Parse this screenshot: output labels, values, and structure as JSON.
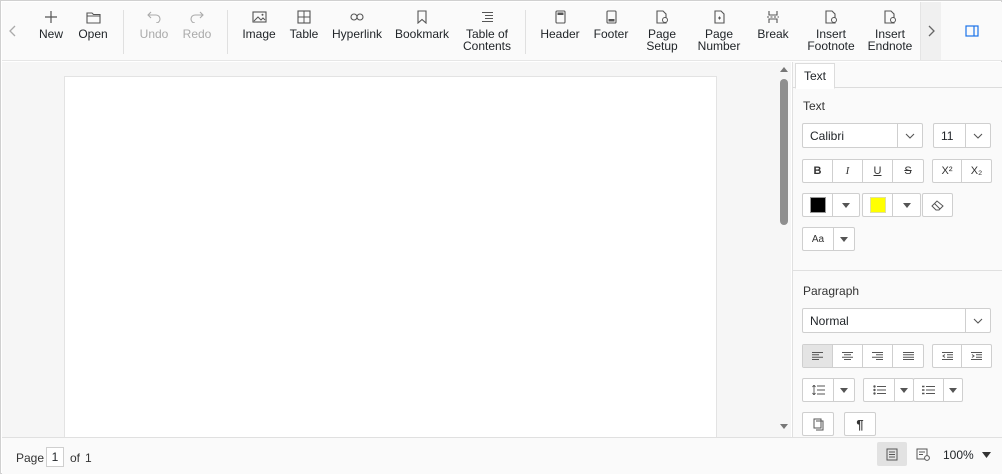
{
  "toolbar": {
    "new_label": "New",
    "open_label": "Open",
    "undo_label": "Undo",
    "redo_label": "Redo",
    "image_label": "Image",
    "table_label": "Table",
    "hyperlink_label": "Hyperlink",
    "bookmark_label": "Bookmark",
    "toc_line1": "Table of",
    "toc_line2": "Contents",
    "header_label": "Header",
    "footer_label": "Footer",
    "page_setup_line1": "Page",
    "page_setup_line2": "Setup",
    "page_number_line1": "Page",
    "page_number_line2": "Number",
    "break_label": "Break",
    "footnote_line1": "Insert",
    "footnote_line2": "Footnote",
    "endnote_line1": "Insert",
    "endnote_line2": "Endnote"
  },
  "pane": {
    "tab_text": "Text",
    "text_section_title": "Text",
    "font_family": "Calibri",
    "font_size": "11",
    "bold": "B",
    "italic": "I",
    "underline": "U",
    "strikethrough": "S",
    "superscript": "X²",
    "subscript": "X₂",
    "font_color": "#000000",
    "highlight_color": "#ffff00",
    "change_case": "Aa",
    "paragraph_section_title": "Paragraph",
    "paragraph_style": "Normal",
    "show_marks": "¶"
  },
  "status": {
    "page_label": "Page",
    "current_page": "1",
    "of_label": "of",
    "total_pages": "1",
    "zoom": "100%"
  },
  "colors": {
    "icon": "#555555",
    "disabled": "#aaaaaa",
    "accent": "#1a73e8"
  }
}
